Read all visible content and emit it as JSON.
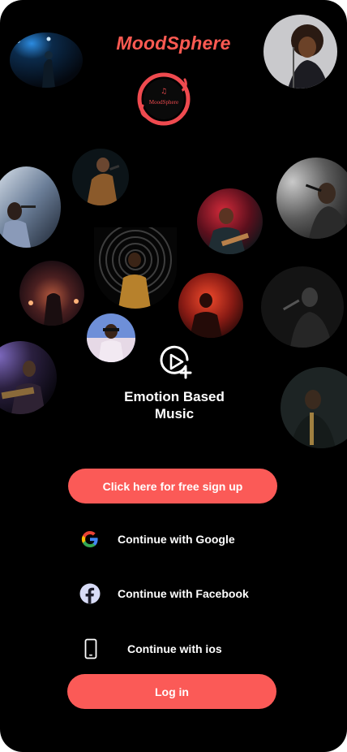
{
  "app": {
    "brand_name": "MoodSphere",
    "logo_text": "MoodSphere",
    "accent_color": "#ff5a52"
  },
  "hero": {
    "icon": "play-add-icon",
    "tagline": "Emotion Based\nMusic"
  },
  "actions": {
    "signup_label": "Click here for free sign up",
    "google_label": "Continue with Google",
    "facebook_label": "Continue with Facebook",
    "ios_label": "Continue with ios",
    "login_label": "Log in"
  },
  "icons": {
    "google": "google-icon",
    "facebook": "facebook-icon",
    "ios": "phone-icon"
  }
}
